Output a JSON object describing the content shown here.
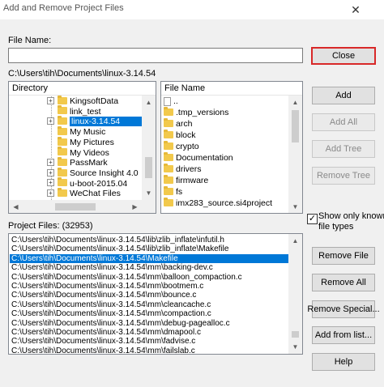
{
  "window": {
    "title": "Add and Remove Project Files",
    "close_glyph": "✕"
  },
  "file_name": {
    "label": "File Name:",
    "value": ""
  },
  "current_path": "C:\\Users\\tih\\Documents\\linux-3.14.54",
  "directory": {
    "header": "Directory",
    "items": [
      {
        "label": "KingsoftData",
        "expand": "+",
        "selected": false
      },
      {
        "label": "link_test",
        "expand": "",
        "selected": false
      },
      {
        "label": "linux-3.14.54",
        "expand": "+",
        "selected": true
      },
      {
        "label": "My Music",
        "expand": "",
        "selected": false
      },
      {
        "label": "My Pictures",
        "expand": "",
        "selected": false
      },
      {
        "label": "My Videos",
        "expand": "",
        "selected": false
      },
      {
        "label": "PassMark",
        "expand": "+",
        "selected": false
      },
      {
        "label": "Source Insight 4.0",
        "expand": "+",
        "selected": false
      },
      {
        "label": "u-boot-2015.04",
        "expand": "+",
        "selected": false
      },
      {
        "label": "WeChat Files",
        "expand": "+",
        "selected": false
      }
    ]
  },
  "file_list": {
    "header": "File Name",
    "items": [
      {
        "label": "..",
        "icon": "file"
      },
      {
        "label": ".tmp_versions",
        "icon": "folder"
      },
      {
        "label": "arch",
        "icon": "folder"
      },
      {
        "label": "block",
        "icon": "folder"
      },
      {
        "label": "crypto",
        "icon": "folder"
      },
      {
        "label": "Documentation",
        "icon": "folder"
      },
      {
        "label": "drivers",
        "icon": "folder"
      },
      {
        "label": "firmware",
        "icon": "folder"
      },
      {
        "label": "fs",
        "icon": "folder"
      },
      {
        "label": "imx283_source.si4project",
        "icon": "folder"
      }
    ]
  },
  "buttons": {
    "close": "Close",
    "add": "Add",
    "add_all": "Add All",
    "add_tree": "Add Tree",
    "remove_tree": "Remove Tree",
    "remove_file": "Remove File",
    "remove_all": "Remove All",
    "remove_special": "Remove Special...",
    "add_from_list": "Add from list...",
    "help": "Help"
  },
  "show_known": {
    "label_line1": "Show only known",
    "label_line2": "file types",
    "checked": true,
    "check_glyph": "✓"
  },
  "project_files": {
    "label": "Project Files: (32953)",
    "items": [
      {
        "path": "C:\\Users\\tih\\Documents\\linux-3.14.54\\lib\\zlib_inflate\\infutil.h",
        "selected": false
      },
      {
        "path": "C:\\Users\\tih\\Documents\\linux-3.14.54\\lib\\zlib_inflate\\Makefile",
        "selected": false
      },
      {
        "path": "C:\\Users\\tih\\Documents\\linux-3.14.54\\Makefile",
        "selected": true
      },
      {
        "path": "C:\\Users\\tih\\Documents\\linux-3.14.54\\mm\\backing-dev.c",
        "selected": false
      },
      {
        "path": "C:\\Users\\tih\\Documents\\linux-3.14.54\\mm\\balloon_compaction.c",
        "selected": false
      },
      {
        "path": "C:\\Users\\tih\\Documents\\linux-3.14.54\\mm\\bootmem.c",
        "selected": false
      },
      {
        "path": "C:\\Users\\tih\\Documents\\linux-3.14.54\\mm\\bounce.c",
        "selected": false
      },
      {
        "path": "C:\\Users\\tih\\Documents\\linux-3.14.54\\mm\\cleancache.c",
        "selected": false
      },
      {
        "path": "C:\\Users\\tih\\Documents\\linux-3.14.54\\mm\\compaction.c",
        "selected": false
      },
      {
        "path": "C:\\Users\\tih\\Documents\\linux-3.14.54\\mm\\debug-pagealloc.c",
        "selected": false
      },
      {
        "path": "C:\\Users\\tih\\Documents\\linux-3.14.54\\mm\\dmapool.c",
        "selected": false
      },
      {
        "path": "C:\\Users\\tih\\Documents\\linux-3.14.54\\mm\\fadvise.c",
        "selected": false
      },
      {
        "path": "C:\\Users\\tih\\Documents\\linux-3.14.54\\mm\\failslab.c",
        "selected": false
      }
    ]
  },
  "scroll_glyphs": {
    "up": "▲",
    "down": "▼",
    "left": "◀",
    "right": "▶"
  },
  "colors": {
    "selection": "#0078d7",
    "focus_border": "#d82828"
  }
}
